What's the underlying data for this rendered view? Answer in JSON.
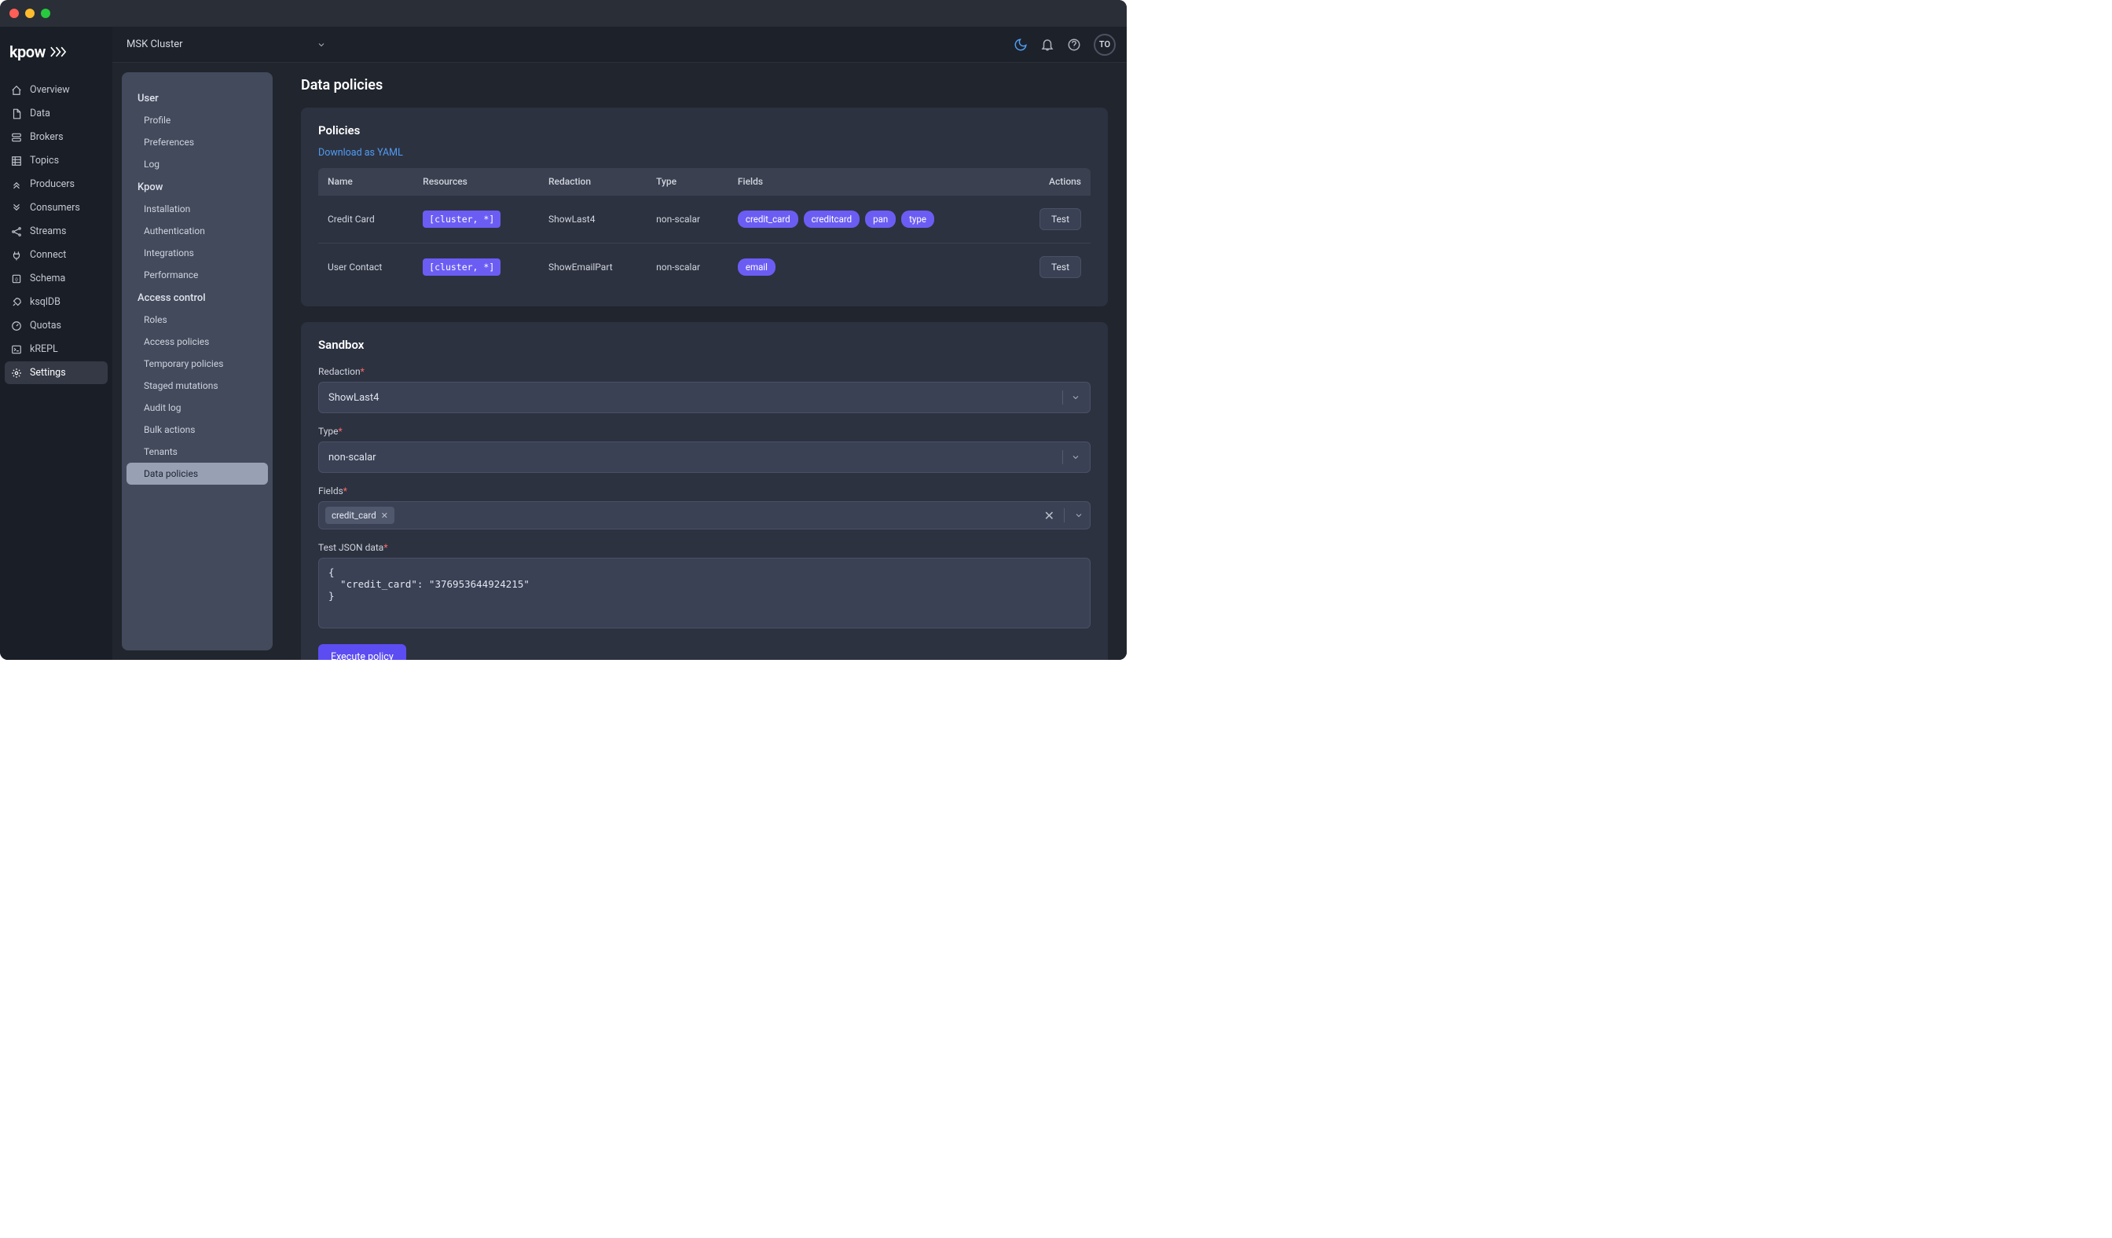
{
  "topbar": {
    "cluster": "MSK Cluster",
    "avatar": "TO"
  },
  "sidebar": {
    "items": [
      {
        "label": "Overview"
      },
      {
        "label": "Data"
      },
      {
        "label": "Brokers"
      },
      {
        "label": "Topics"
      },
      {
        "label": "Producers"
      },
      {
        "label": "Consumers"
      },
      {
        "label": "Streams"
      },
      {
        "label": "Connect"
      },
      {
        "label": "Schema"
      },
      {
        "label": "ksqlDB"
      },
      {
        "label": "Quotas"
      },
      {
        "label": "kREPL"
      },
      {
        "label": "Settings"
      }
    ]
  },
  "subnav": {
    "groups": [
      {
        "header": "User",
        "items": [
          "Profile",
          "Preferences",
          "Log"
        ]
      },
      {
        "header": "Kpow",
        "items": [
          "Installation",
          "Authentication",
          "Integrations",
          "Performance"
        ]
      },
      {
        "header": "Access control",
        "items": [
          "Roles",
          "Access policies",
          "Temporary policies",
          "Staged mutations",
          "Audit log",
          "Bulk actions",
          "Tenants",
          "Data policies"
        ]
      }
    ],
    "active": "Data policies"
  },
  "page": {
    "title": "Data policies"
  },
  "policies_card": {
    "title": "Policies",
    "download_link": "Download as YAML",
    "columns": [
      "Name",
      "Resources",
      "Redaction",
      "Type",
      "Fields",
      "Actions"
    ],
    "rows": [
      {
        "name": "Credit Card",
        "resource": "[cluster, *]",
        "redaction": "ShowLast4",
        "type": "non-scalar",
        "fields": [
          "credit_card",
          "creditcard",
          "pan",
          "type"
        ],
        "action": "Test"
      },
      {
        "name": "User Contact",
        "resource": "[cluster, *]",
        "redaction": "ShowEmailPart",
        "type": "non-scalar",
        "fields": [
          "email"
        ],
        "action": "Test"
      }
    ]
  },
  "sandbox": {
    "title": "Sandbox",
    "redaction_label": "Redaction",
    "redaction_value": "ShowLast4",
    "type_label": "Type",
    "type_value": "non-scalar",
    "fields_label": "Fields",
    "field_tags": [
      "credit_card"
    ],
    "json_label": "Test JSON data",
    "json_value": "{\n  \"credit_card\": \"376953644924215\"\n}",
    "execute_label": "Execute policy"
  }
}
